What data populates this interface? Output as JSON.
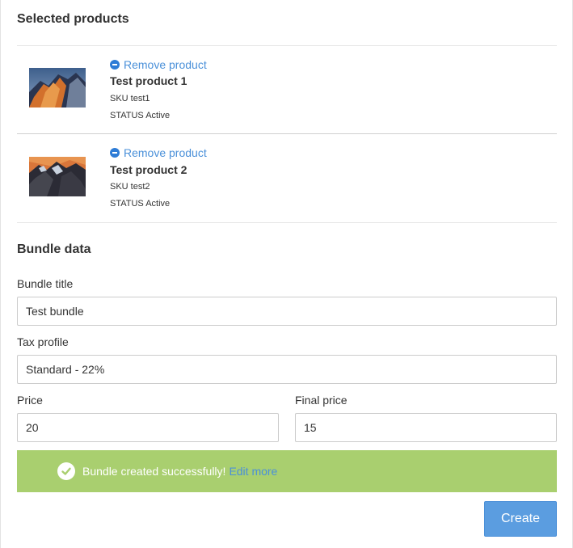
{
  "selected_products": {
    "heading": "Selected products",
    "items": [
      {
        "remove_label": "Remove product",
        "name": "Test product 1",
        "sku": "SKU test1",
        "status": "STATUS Active"
      },
      {
        "remove_label": "Remove product",
        "name": "Test product 2",
        "sku": "SKU test2",
        "status": "STATUS Active"
      }
    ]
  },
  "bundle_data": {
    "heading": "Bundle data",
    "title_label": "Bundle title",
    "title_value": "Test bundle",
    "tax_label": "Tax profile",
    "tax_value": "Standard - 22%",
    "price_label": "Price",
    "price_value": "20",
    "final_price_label": "Final price",
    "final_price_value": "15"
  },
  "alert": {
    "message": "Bundle created successfully!",
    "link": "Edit more"
  },
  "actions": {
    "create_label": "Create"
  },
  "colors": {
    "accent_link": "#4a90d9",
    "success_bg": "#a9cf6f",
    "primary_button": "#5b9de0"
  },
  "icons": [
    "minus-circle-icon",
    "check-circle-icon"
  ]
}
